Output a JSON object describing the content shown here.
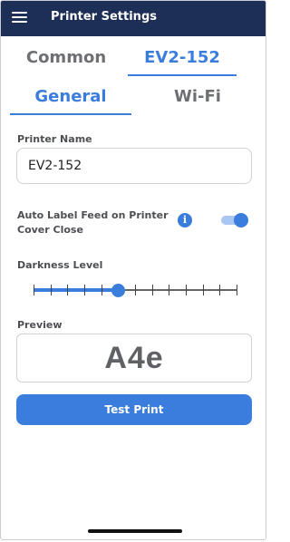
{
  "header": {
    "title": "Printer Settings",
    "menu_icon": "hamburger-menu-icon"
  },
  "device_tabs": [
    {
      "label": "Common",
      "active": false
    },
    {
      "label": "EV2-152",
      "active": true
    }
  ],
  "section_tabs": [
    {
      "label": "General",
      "active": true
    },
    {
      "label": "Wi-Fi",
      "active": false
    }
  ],
  "printer_name": {
    "label": "Printer Name",
    "value": "EV2-152"
  },
  "auto_label_feed": {
    "label": "Auto Label Feed on Printer Cover Close",
    "enabled": true,
    "info_icon": "info-icon"
  },
  "darkness": {
    "label": "Darkness Level",
    "value": 6,
    "max": 13
  },
  "preview": {
    "label": "Preview",
    "text": "A4e"
  },
  "test_print": {
    "label": "Test Print"
  },
  "colors": {
    "accent": "#3b7ddd",
    "header": "#1d2f56",
    "inactive_tab": "#6d6f73"
  }
}
